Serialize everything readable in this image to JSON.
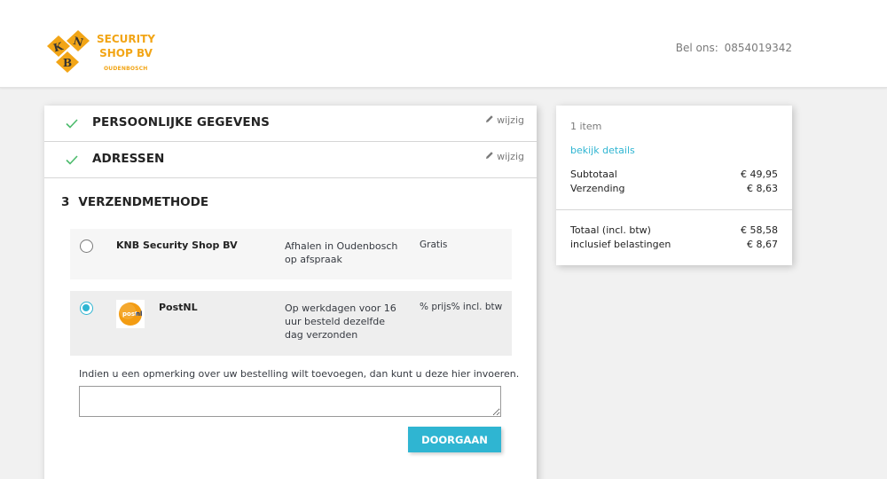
{
  "header": {
    "logo_text": "SECURITY SHOP BV",
    "logo_line1": "SECURITY",
    "logo_line2": "SHOP BV",
    "logo_sub": "OUDENBOSCH",
    "phone_label": "Bel ons:",
    "phone_number": "0854019342"
  },
  "steps": [
    {
      "title": "PERSOONLIJKE GEGEVENS",
      "edit_label": "wijzig"
    },
    {
      "title": "ADRESSEN",
      "edit_label": "wijzig"
    }
  ],
  "current_step": {
    "number": "3",
    "title": "VERZENDMETHODE",
    "carriers": [
      {
        "name": "KNB Security Shop BV",
        "delay": "Afhalen in Oudenbosch op afspraak",
        "price": "Gratis",
        "selected": false,
        "logo": null
      },
      {
        "name": "PostNL",
        "delay": "Op werkdagen voor 16 uur besteld dezelfde dag verzonden",
        "price": "% prijs% incl. btw",
        "selected": true,
        "logo": "postnl-logo"
      }
    ],
    "comment_label": "Indien u een opmerking over uw bestelling wilt toevoegen, dan kunt u deze hier invoeren.",
    "comment_value": "",
    "continue_label": "DOORGAAN"
  },
  "summary": {
    "items_count": "1 item",
    "details_link": "bekijk details",
    "subtotal_label": "Subtotaal",
    "subtotal_value": "€ 49,95",
    "shipping_label": "Verzending",
    "shipping_value": "€ 8,63",
    "total_label": "Totaal (incl. btw)",
    "total_value": "€ 58,58",
    "tax_label": "inclusief belastingen",
    "tax_value": "€ 8,67"
  },
  "colors": {
    "accent": "#2fb5d2",
    "brand": "#f2a516",
    "check": "#4cbb6c"
  }
}
